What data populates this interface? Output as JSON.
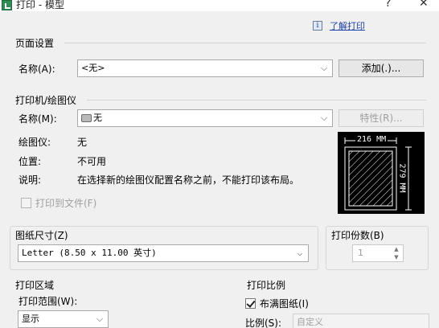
{
  "window": {
    "title": "打印 - 模型",
    "help_button": "?",
    "close_button": "✕"
  },
  "help": {
    "link": "了解打印",
    "info_icon": "i"
  },
  "page_setup": {
    "title": "页面设置",
    "name_label": "名称(A):",
    "name_value": "<无>",
    "add_button": "添加(.)..."
  },
  "printer": {
    "title": "打印机/绘图仪",
    "name_label": "名称(M):",
    "name_value": "无",
    "properties_button": "特性(R)...",
    "plotter_label": "绘图仪:",
    "plotter_value": "无",
    "location_label": "位置:",
    "location_value": "不可用",
    "description_label": "说明:",
    "description_value": "在选择新的绘图仪配置名称之前，不能打印该布局。",
    "print_to_file_label": "打印到文件(F)",
    "print_to_file_checked": false
  },
  "preview": {
    "width_label": "216 MM",
    "height_label": "279 MM"
  },
  "paper_size": {
    "title": "图纸尺寸(Z)",
    "value": "Letter (8.50 x 11.00 英寸)"
  },
  "copies": {
    "title": "打印份数(B)",
    "value": "1"
  },
  "plot_area": {
    "title": "打印区域",
    "range_label": "打印范围(W):",
    "range_value": "显示"
  },
  "plot_scale": {
    "title": "打印比例",
    "fit_label": "布满图纸(I)",
    "fit_checked": true,
    "scale_label": "比例(S):",
    "scale_value": "自定义"
  }
}
